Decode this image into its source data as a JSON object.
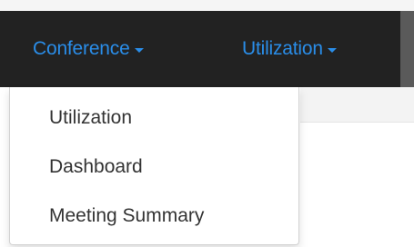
{
  "navbar": {
    "items": [
      {
        "label": "Conference",
        "icon": "caret-down-icon"
      },
      {
        "label": "Utilization",
        "icon": "caret-down-icon"
      }
    ]
  },
  "dropdown": {
    "items": [
      {
        "label": "Utilization"
      },
      {
        "label": "Dashboard"
      },
      {
        "label": "Meeting Summary"
      }
    ]
  },
  "colors": {
    "navbar_bg": "#222222",
    "nav_link": "#2a8de8",
    "menu_text": "#333333"
  }
}
